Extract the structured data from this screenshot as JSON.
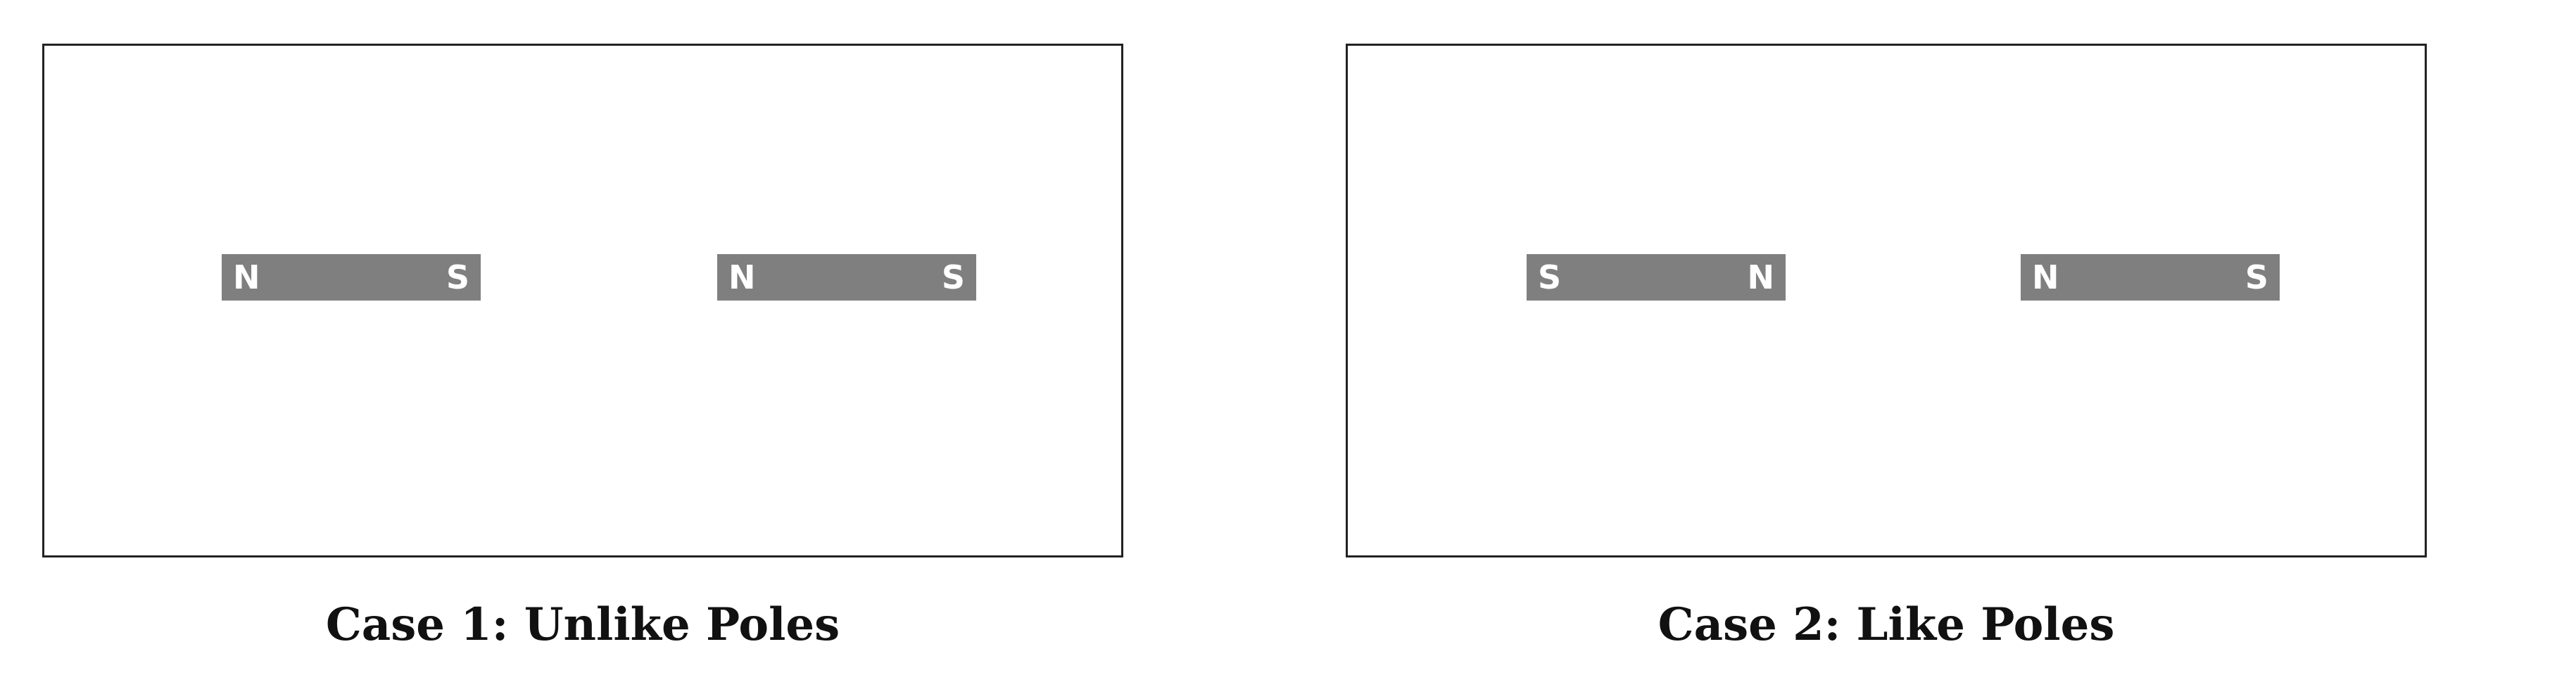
{
  "colors": {
    "magnet_fill": "#7f7f7f",
    "pole_text": "#ffffff",
    "frame_border": "#222222",
    "background": "#ffffff"
  },
  "cases": [
    {
      "caption": "Case 1: Unlike Poles",
      "magnets": [
        {
          "left_pole": "N",
          "right_pole": "S"
        },
        {
          "left_pole": "N",
          "right_pole": "S"
        }
      ]
    },
    {
      "caption": "Case 2: Like Poles",
      "magnets": [
        {
          "left_pole": "S",
          "right_pole": "N"
        },
        {
          "left_pole": "N",
          "right_pole": "S"
        }
      ]
    }
  ]
}
